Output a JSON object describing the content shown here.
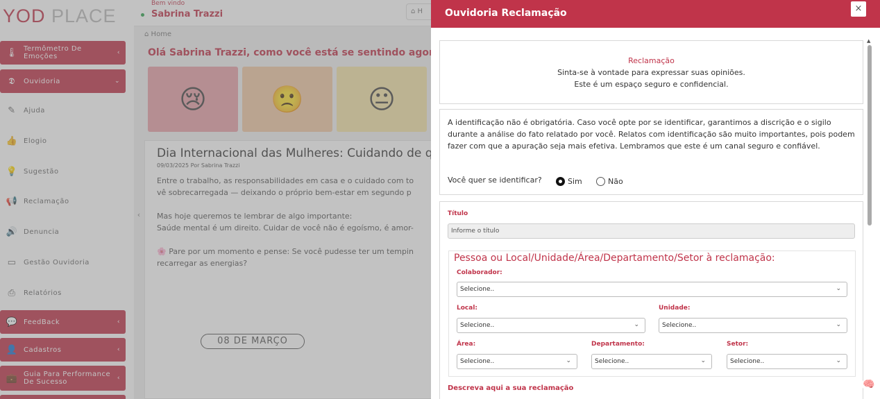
{
  "logo": {
    "main": "YOD",
    "light": " PLACE"
  },
  "header": {
    "welcome": "Bem vindo",
    "user": "Sabrina Trazzi",
    "home_btn": "H"
  },
  "sidebar": {
    "items": [
      {
        "label": "Termômetro De Emoções",
        "icon": "thermometer-icon"
      },
      {
        "label": "Ouvidoria",
        "icon": "ear-icon"
      },
      {
        "label": "Ajuda",
        "icon": "help-icon"
      },
      {
        "label": "Elogio",
        "icon": "thumbs-up-icon"
      },
      {
        "label": "Sugestão",
        "icon": "lightbulb-icon"
      },
      {
        "label": "Reclamação",
        "icon": "megaphone-icon"
      },
      {
        "label": "Denuncia",
        "icon": "speaker-icon"
      },
      {
        "label": "Gestão Ouvidoria",
        "icon": "folder-icon"
      },
      {
        "label": "Relatórios",
        "icon": "printer-icon"
      },
      {
        "label": "FeedBack",
        "icon": "chat-icon"
      },
      {
        "label": "Cadastros",
        "icon": "user-card-icon"
      },
      {
        "label": "Guia Para Performance De Sucesso",
        "icon": "briefcase-icon"
      }
    ]
  },
  "main": {
    "breadcrumb": "Home",
    "feel_title": "Olá Sabrina Trazzi, como você está se sentindo agora?",
    "moods": [
      {
        "emoji": "😢",
        "color": "#e8a0a8"
      },
      {
        "emoji": "🙁",
        "color": "#f1c9a5"
      },
      {
        "emoji": "😐",
        "color": "#f4e3a8"
      }
    ],
    "post": {
      "title": "Dia Internacional das Mulheres: Cuidando de quem c",
      "meta": "09/03/2025 Por Sabrina Trazzi",
      "p1a": "Entre o trabalho, as responsabilidades em casa e o cuidado com to",
      "p1b": "vê sobrecarregada — deixando o próprio bem-estar em segundo p",
      "p2a": "Mas hoje queremos te lembrar de algo importante:",
      "p2b": "Saúde mental é um direito. Cuidar de você não é egoísmo, é amor-",
      "p3a": "🌸 Pare por um momento e pense: Se você pudesse ter um tempin",
      "p3b": "recarregar as energias?",
      "stamp": "08 DE MARÇO"
    }
  },
  "panel": {
    "title": "Ouvidoria Reclamação",
    "close": "×",
    "intro_title": "Reclamação",
    "intro_l1": "Sinta-se à vontade para expressar suas opiniões.",
    "intro_l2": "Este é um espaço seguro e confidencial.",
    "id_text": "A identificação não é obrigatória. Caso você opte por se identificar, garantimos a discrição e o sigilo durante a análise do fato relatado por você. Relatos com identificação são muito importantes, pois podem fazer com que a apuração seja mais efetiva. Lembramos que este é um canal seguro e confiável.",
    "id_question": "Você quer se identificar?",
    "opt_yes": "Sim",
    "opt_no": "Não",
    "titulo_label": "Título",
    "titulo_placeholder": "Informe o título",
    "section_heading": "Pessoa ou Local/Unidade/Área/Departamento/Setor à reclamação:",
    "colaborador": "Colaborador:",
    "local": "Local:",
    "unidade": "Unidade:",
    "area": "Área:",
    "departamento": "Departamento:",
    "setor": "Setor:",
    "select_val": "Selecione..",
    "describe_label": "Descreva aqui a sua reclamação"
  },
  "colors": {
    "accent": "#c0344a"
  }
}
